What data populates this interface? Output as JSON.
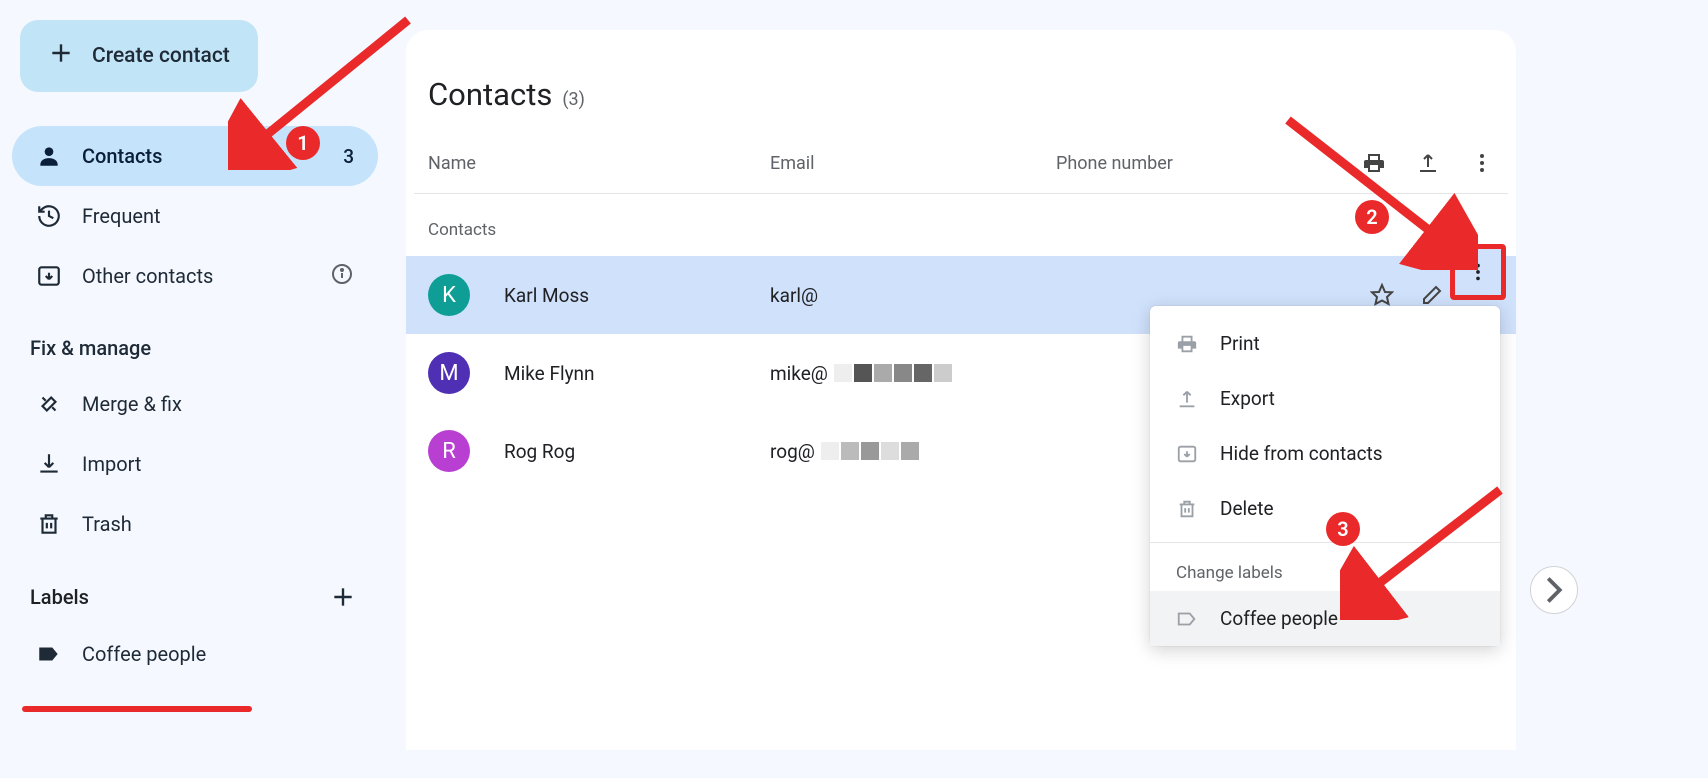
{
  "sidebar": {
    "create_label": "Create contact",
    "nav": [
      {
        "label": "Contacts",
        "count": "3"
      },
      {
        "label": "Frequent"
      },
      {
        "label": "Other contacts"
      }
    ],
    "fix_manage_header": "Fix & manage",
    "fix_manage": [
      {
        "label": "Merge & fix"
      },
      {
        "label": "Import"
      },
      {
        "label": "Trash"
      }
    ],
    "labels_header": "Labels",
    "labels": [
      {
        "label": "Coffee people"
      }
    ]
  },
  "main": {
    "title": "Contacts",
    "title_count": "(3)",
    "columns": {
      "name": "Name",
      "email": "Email",
      "phone": "Phone number"
    },
    "group_label": "Contacts",
    "rows": [
      {
        "initial": "K",
        "color": "#0e9e96",
        "name": "Karl Moss",
        "email": "karl@"
      },
      {
        "initial": "M",
        "color": "#4f2fb3",
        "name": "Mike Flynn",
        "email": "mike@"
      },
      {
        "initial": "R",
        "color": "#b83fd1",
        "name": "Rog Rog",
        "email": "rog@"
      }
    ]
  },
  "menu": {
    "items": [
      {
        "label": "Print"
      },
      {
        "label": "Export"
      },
      {
        "label": "Hide from contacts"
      },
      {
        "label": "Delete"
      }
    ],
    "section_label": "Change labels",
    "label_option": "Coffee people"
  },
  "annotations": {
    "b1": "1",
    "b2": "2",
    "b3": "3"
  }
}
